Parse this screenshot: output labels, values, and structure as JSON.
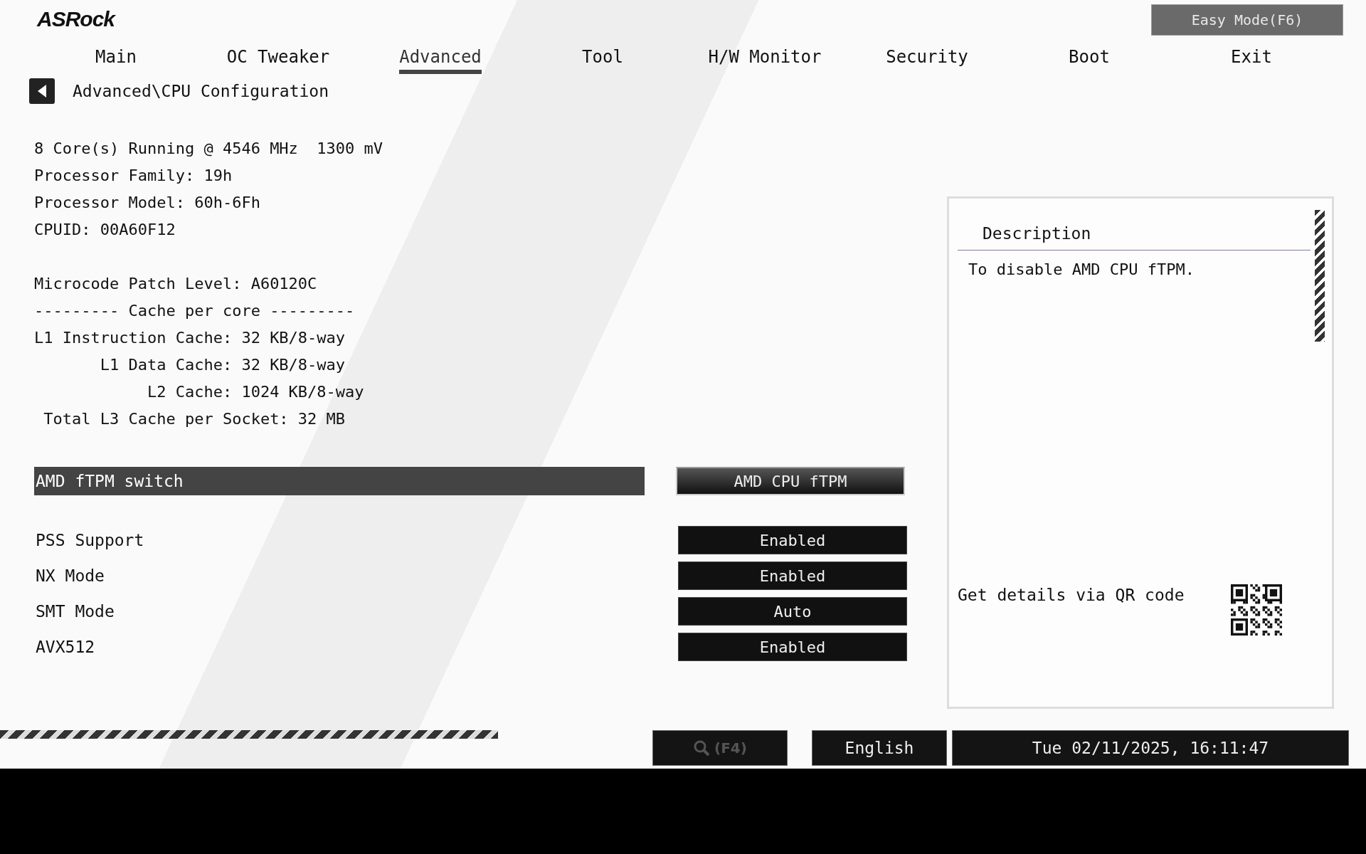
{
  "logo": "ASRock",
  "easy_mode_button": "Easy Mode(F6)",
  "tabs": [
    {
      "label": "Main",
      "selected": false
    },
    {
      "label": "OC Tweaker",
      "selected": false
    },
    {
      "label": "Advanced",
      "selected": true
    },
    {
      "label": "Tool",
      "selected": false
    },
    {
      "label": "H/W Monitor",
      "selected": false
    },
    {
      "label": "Security",
      "selected": false
    },
    {
      "label": "Boot",
      "selected": false
    },
    {
      "label": "Exit",
      "selected": false
    }
  ],
  "breadcrumb": "Advanced\\CPU Configuration",
  "info_groups": [
    [
      "8 Core(s) Running @ 4546 MHz  1300 mV",
      "Processor Family: 19h",
      "Processor Model: 60h-6Fh",
      "CPUID: 00A60F12"
    ],
    [
      "Microcode Patch Level: A60120C",
      "--------- Cache per core ---------",
      "L1 Instruction Cache: 32 KB/8-way",
      "       L1 Data Cache: 32 KB/8-way",
      "            L2 Cache: 1024 KB/8-way",
      " Total L3 Cache per Socket: 32 MB"
    ]
  ],
  "settings": [
    {
      "kind": "submenu",
      "label": "AMD fTPM switch",
      "value": "AMD CPU fTPM",
      "selected": true
    },
    {
      "kind": "option",
      "label": "PSS Support",
      "value": "Enabled",
      "selected": false
    },
    {
      "kind": "option",
      "label": "NX Mode",
      "value": "Enabled",
      "selected": false
    },
    {
      "kind": "option",
      "label": "SMT Mode",
      "value": "Auto",
      "selected": false
    },
    {
      "kind": "option",
      "label": "AVX512",
      "value": "Enabled",
      "selected": false
    }
  ],
  "description": {
    "title": "Description",
    "text": "To disable AMD CPU fTPM.",
    "qr_label": "Get details via QR code"
  },
  "status_bar": {
    "search_key": "(F4)",
    "language": "English",
    "datetime": "Tue 02/11/2025, 16:11:47"
  }
}
